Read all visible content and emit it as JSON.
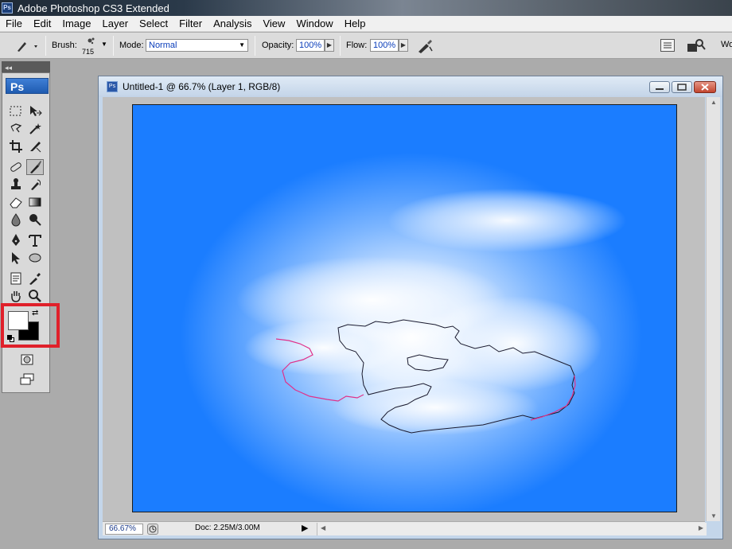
{
  "app": {
    "title": "Adobe Photoshop CS3 Extended",
    "icon": "ps-app-icon"
  },
  "menu": [
    "File",
    "Edit",
    "Image",
    "Layer",
    "Select",
    "Filter",
    "Analysis",
    "View",
    "Window",
    "Help"
  ],
  "options": {
    "brush_label": "Brush:",
    "brush_size": "715",
    "mode_label": "Mode:",
    "mode_value": "Normal",
    "opacity_label": "Opacity:",
    "opacity_value": "100%",
    "flow_label": "Flow:",
    "flow_value": "100%",
    "workspace_label": "Wo"
  },
  "toolbox": {
    "logo": "Ps",
    "highlight_color": "#e0202a",
    "foreground_color": "#ffffff",
    "background_color": "#000000"
  },
  "document": {
    "title": "Untitled-1 @ 66.7% (Layer 1, RGB/8)",
    "zoom": "66.67%",
    "doc_info": "Doc: 2.25M/3.00M",
    "canvas_colors": {
      "sky": "#1b7dff",
      "cloud": "#ffffff",
      "selection_path": "#1a1a2e",
      "highlight_path": "#e0318a"
    }
  }
}
